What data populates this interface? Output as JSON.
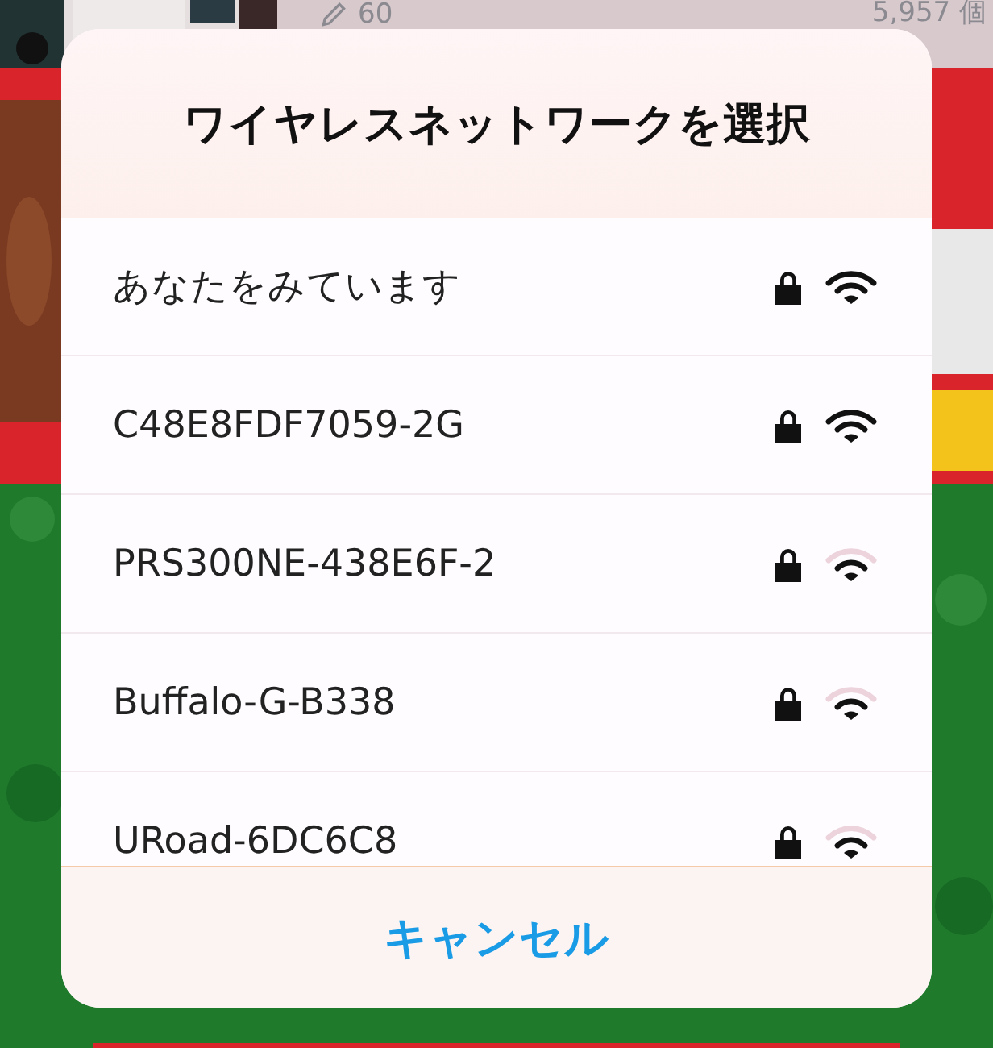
{
  "background_page": {
    "edit_count": "60",
    "sales_count": "5,957 個"
  },
  "dialog": {
    "title": "ワイヤレスネットワークを選択",
    "networks": [
      {
        "name": "あなたをみています",
        "locked": true,
        "weak_signal": false
      },
      {
        "name": "C48E8FDF7059-2G",
        "locked": true,
        "weak_signal": false
      },
      {
        "name": "PRS300NE-438E6F-2",
        "locked": true,
        "weak_signal": true
      },
      {
        "name": "Buffalo-G-B338",
        "locked": true,
        "weak_signal": true
      },
      {
        "name": "URoad-6DC6C8",
        "locked": true,
        "weak_signal": true
      }
    ],
    "cancel_button": "キャンセル"
  }
}
